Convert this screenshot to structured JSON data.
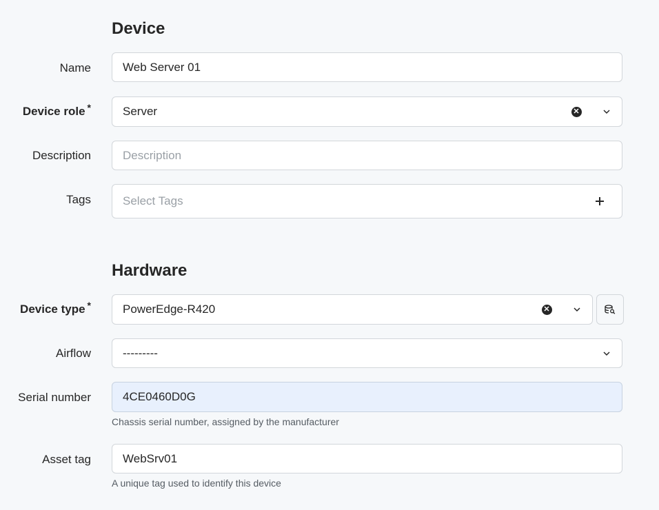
{
  "sections": {
    "device_title": "Device",
    "hardware_title": "Hardware"
  },
  "fields": {
    "name": {
      "label": "Name",
      "value": "Web Server 01"
    },
    "device_role": {
      "label": "Device role",
      "required_mark": "*",
      "value": "Server"
    },
    "description": {
      "label": "Description",
      "placeholder": "Description"
    },
    "tags": {
      "label": "Tags",
      "placeholder": "Select Tags"
    },
    "device_type": {
      "label": "Device type",
      "required_mark": "*",
      "value": "PowerEdge-R420"
    },
    "airflow": {
      "label": "Airflow",
      "value": "---------"
    },
    "serial_number": {
      "label": "Serial number",
      "value": "4CE0460D0G",
      "help": "Chassis serial number, assigned by the manufacturer"
    },
    "asset_tag": {
      "label": "Asset tag",
      "value": "WebSrv01",
      "help": "A unique tag used to identify this device"
    }
  },
  "icons": {
    "clear": "clear-x-icon",
    "dropdown": "chevron-down-icon",
    "add": "plus-icon",
    "selector": "database-search-icon"
  }
}
